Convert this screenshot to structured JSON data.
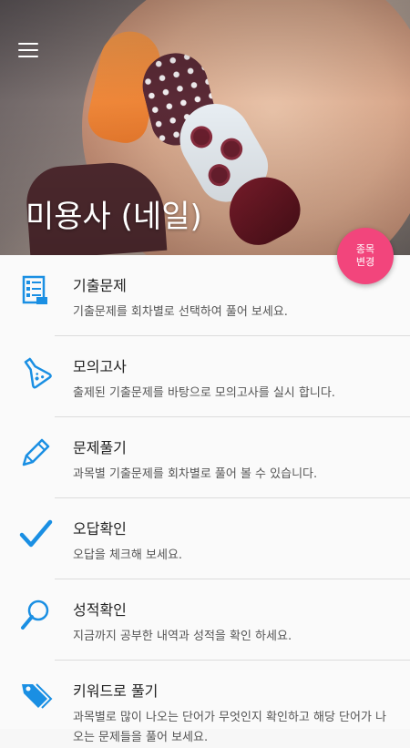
{
  "header": {
    "title": "미용사 (네일)",
    "menu_icon": "hamburger-menu-icon"
  },
  "fab": {
    "line1": "종목",
    "line2": "변경"
  },
  "menu": {
    "items": [
      {
        "label": "기출문제",
        "desc": "기출문제를 회차별로 선택하여 풀어 보세요.",
        "icon": "exam-paper-icon"
      },
      {
        "label": "모의고사",
        "desc": "출제된 기출문제를 바탕으로 모의고사를 실시 합니다.",
        "icon": "flask-icon"
      },
      {
        "label": "문제풀기",
        "desc": "과목별 기출문제를 회차별로 풀어 볼 수 있습니다.",
        "icon": "pencil-icon"
      },
      {
        "label": "오답확인",
        "desc": "오답을 체크해 보세요.",
        "icon": "checkmark-icon"
      },
      {
        "label": "성적확인",
        "desc": "지금까지 공부한 내역과 성적을 확인 하세요.",
        "icon": "magnifier-icon"
      },
      {
        "label": "키워드로 풀기",
        "desc": "과목별로 많이 나오는 단어가 무엇인지 확인하고 해당 단어가 나오는 문제들을 풀어 보세요.",
        "icon": "tags-icon"
      }
    ]
  },
  "colors": {
    "accent": "#1a8fe3",
    "fab": "#f2457c"
  }
}
